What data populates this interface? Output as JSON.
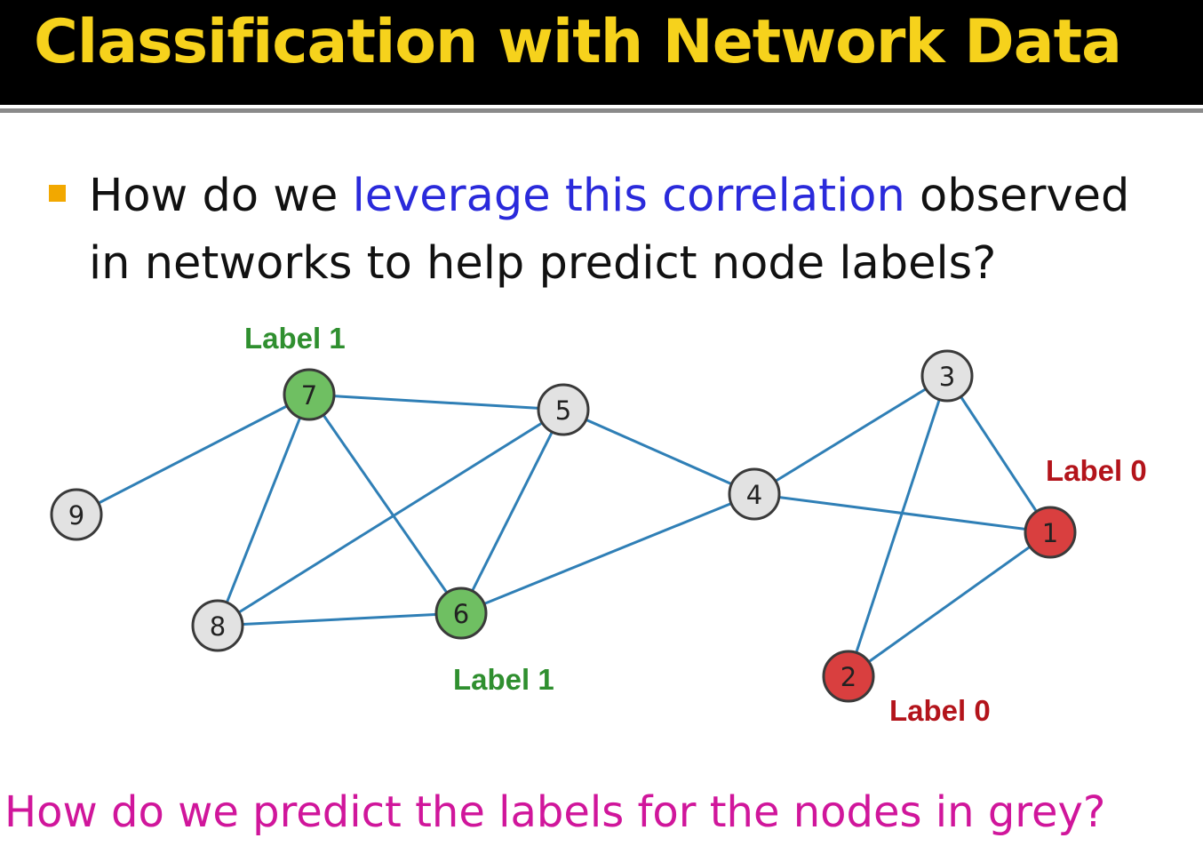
{
  "header": {
    "title": "Classification with Network Data"
  },
  "bullet": {
    "prefix": "How do we ",
    "highlight": "leverage this correlation",
    "suffix": " observed in networks to help predict node labels?"
  },
  "graph": {
    "nodes": [
      {
        "id": "1",
        "label": "1",
        "color": "#d93f3f"
      },
      {
        "id": "2",
        "label": "2",
        "color": "#d93f3f"
      },
      {
        "id": "3",
        "label": "3",
        "color": "#e2e2e2"
      },
      {
        "id": "4",
        "label": "4",
        "color": "#e2e2e2"
      },
      {
        "id": "5",
        "label": "5",
        "color": "#e2e2e2"
      },
      {
        "id": "6",
        "label": "6",
        "color": "#6fbf62"
      },
      {
        "id": "7",
        "label": "7",
        "color": "#6fbf62"
      },
      {
        "id": "8",
        "label": "8",
        "color": "#e2e2e2"
      },
      {
        "id": "9",
        "label": "9",
        "color": "#e2e2e2"
      }
    ],
    "edges": [
      [
        "9",
        "7"
      ],
      [
        "7",
        "5"
      ],
      [
        "7",
        "8"
      ],
      [
        "7",
        "6"
      ],
      [
        "5",
        "8"
      ],
      [
        "5",
        "6"
      ],
      [
        "5",
        "4"
      ],
      [
        "8",
        "6"
      ],
      [
        "6",
        "4"
      ],
      [
        "4",
        "3"
      ],
      [
        "4",
        "1"
      ],
      [
        "3",
        "1"
      ],
      [
        "3",
        "2"
      ],
      [
        "2",
        "1"
      ]
    ],
    "annotations": {
      "node7": {
        "text": "Label 1",
        "color": "#2f8f2f"
      },
      "node6": {
        "text": "Label 1",
        "color": "#2f8f2f"
      },
      "node1": {
        "text": "Label 0",
        "color": "#b3141b"
      },
      "node2": {
        "text": "Label 0",
        "color": "#b3141b"
      }
    }
  },
  "footer": {
    "question": "How do we predict the labels for the nodes in grey?"
  }
}
